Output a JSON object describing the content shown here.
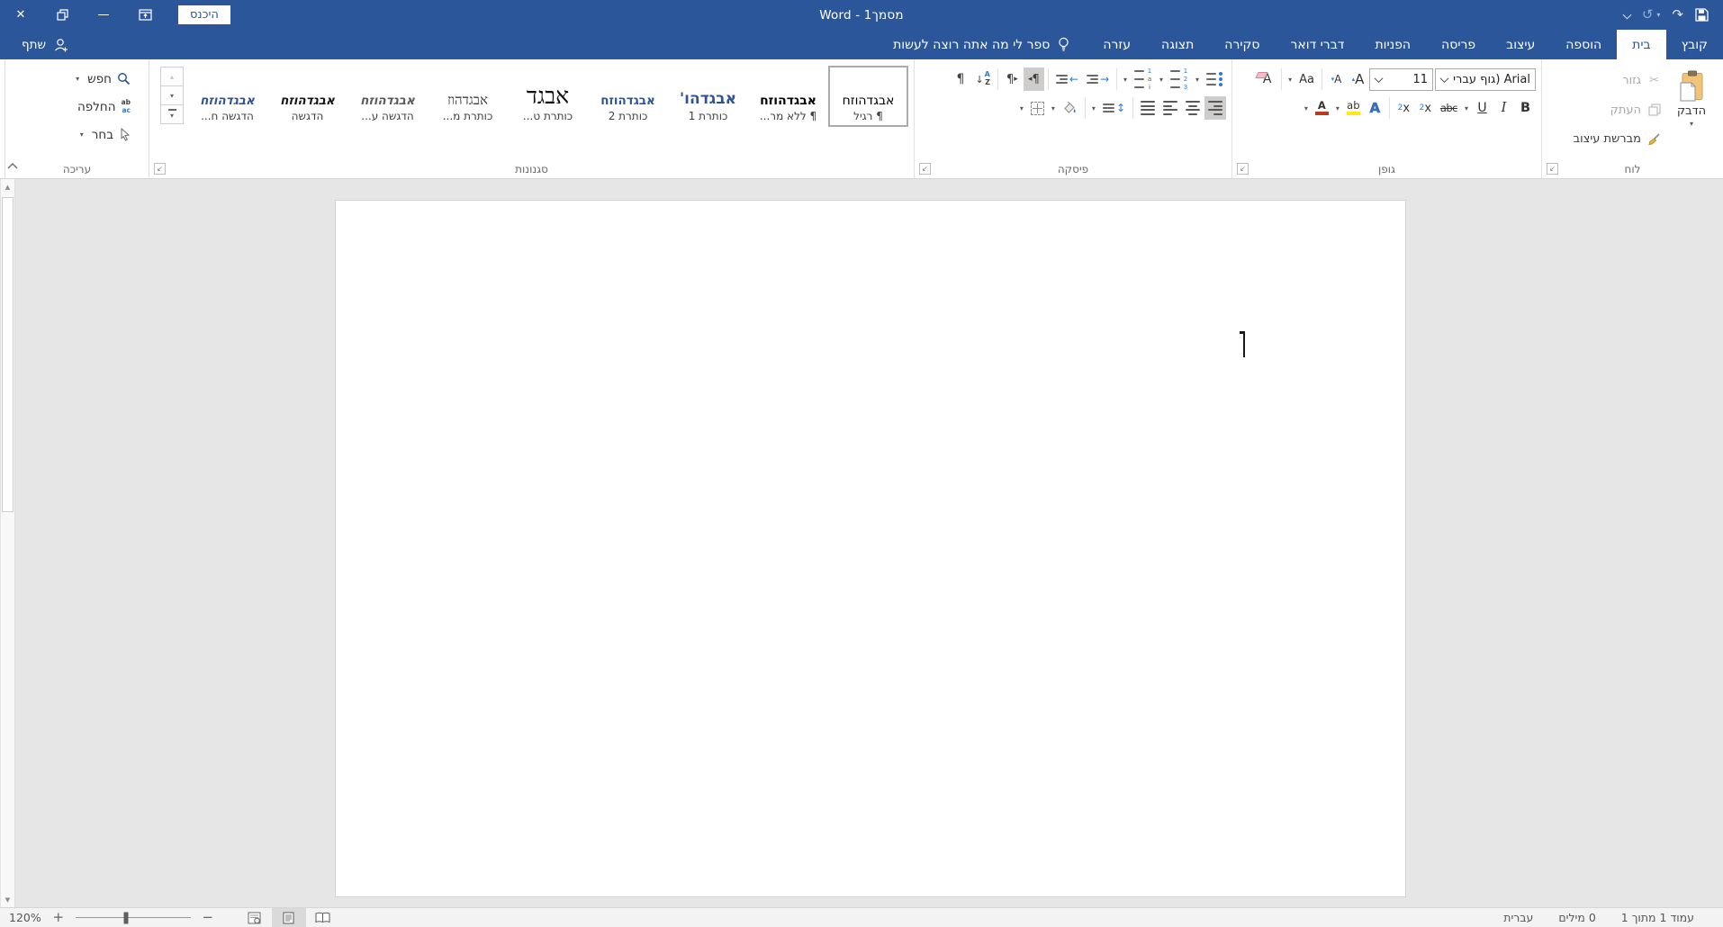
{
  "titlebar": {
    "title": "מסמך1 - Word",
    "sign_in": "היכנס"
  },
  "tabs": {
    "file": "קובץ",
    "items": [
      "בית",
      "הוספה",
      "עיצוב",
      "פריסה",
      "הפניות",
      "דברי דואר",
      "סקירה",
      "תצוגה",
      "עזרה"
    ],
    "tell_me": "ספר לי מה אתה רוצה לעשות",
    "share": "שתף"
  },
  "ribbon": {
    "clipboard": {
      "label": "לוח",
      "paste": "הדבק",
      "cut": "גזור",
      "copy": "העתק",
      "format_painter": "מברשת עיצוב"
    },
    "font": {
      "label": "גופן",
      "name": "Arial (גוף עברי)",
      "size": "11",
      "bold": "B",
      "italic": "I",
      "underline": "U",
      "strike": "abc",
      "sub_base": "x",
      "sub": "2",
      "sup_base": "x",
      "sup": "2",
      "case": "Aa",
      "effects": "A",
      "highlight": "ab",
      "color": "A",
      "clear": "A",
      "grow": "A",
      "shrink": "A"
    },
    "paragraph": {
      "label": "פיסקה",
      "pilcrow": "¶",
      "sort_top": "A",
      "sort_bottom": "Z",
      "levels": [
        "1",
        "a",
        "i"
      ],
      "numbers": [
        "1",
        "2",
        "3"
      ]
    },
    "styles": {
      "label": "סגנונות",
      "items": [
        {
          "sample": "אבגדהוזח",
          "name": "¶ רגיל"
        },
        {
          "sample": "אבגדהוזח",
          "name": "¶ ללא מר..."
        },
        {
          "sample": "אבגדהו'",
          "name": "כותרת 1"
        },
        {
          "sample": "אבגדהוזח",
          "name": "כותרת 2"
        },
        {
          "sample": "אבגד",
          "name": "כותרת ט..."
        },
        {
          "sample": "אבגדהוז",
          "name": "כותרת מ..."
        },
        {
          "sample": "אבגדהוזח",
          "name": "הדגשה ע..."
        },
        {
          "sample": "אבגדהוזח",
          "name": "הדגשה"
        },
        {
          "sample": "אבגדהוזח",
          "name": "הדגשה ח..."
        }
      ]
    },
    "editing": {
      "label": "עריכה",
      "find": "חפש",
      "replace": "החלפה",
      "select": "בחר",
      "replace_top": "ab",
      "replace_bottom": "ac"
    }
  },
  "statusbar": {
    "page_info": "עמוד 1 מתוך 1",
    "words": "0 מילים",
    "language": "עברית",
    "zoom": "120%"
  },
  "glyphs": {
    "close": "✕",
    "minimize": "—",
    "undo": "↺",
    "redo": "↷",
    "caret": "▾",
    "caret_up": "▴",
    "cut": "✂",
    "updown": "↕",
    "arrow_left": "←",
    "arrow_right": "→",
    "ltr_tri": "▸",
    "rtl_tri": "◂",
    "sort_arrow": "↓",
    "scroll_up": "▲",
    "scroll_down": "▼",
    "launcher": "↙",
    "plus": "+",
    "minus": "−"
  },
  "colors": {
    "brand": "#2b579a",
    "font_color_swatch": "#c0391b",
    "highlight_swatch": "#ffe81a"
  }
}
